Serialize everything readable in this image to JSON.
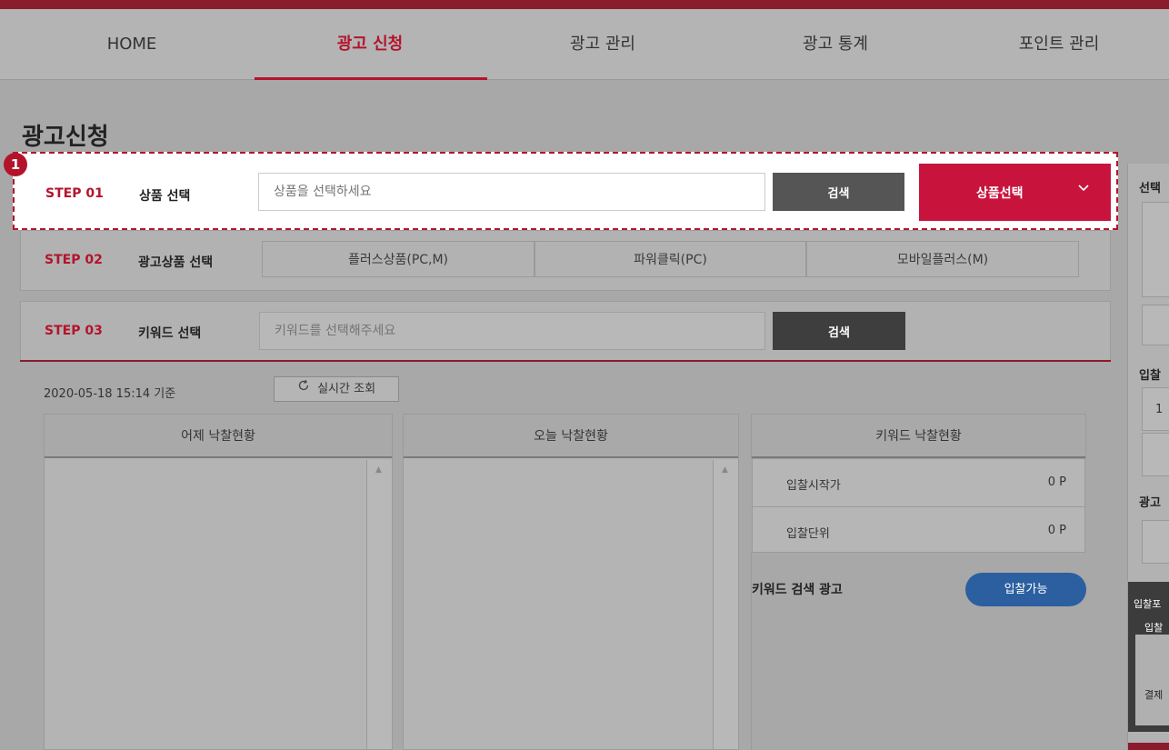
{
  "nav": {
    "items": [
      "HOME",
      "광고 신청",
      "광고 관리",
      "광고 통계",
      "포인트 관리"
    ],
    "active": "광고 신청"
  },
  "page": {
    "title": "광고신청",
    "callout_number": "1"
  },
  "step1": {
    "label": "STEP 01",
    "title": "상품 선택",
    "input_placeholder": "상품을 선택하세요",
    "search_label": "검색",
    "select_label": "상품선택",
    "select_icon": "chevron-down-icon"
  },
  "step2": {
    "label": "STEP 02",
    "title": "광고상품 선택",
    "options": [
      "플러스상품(PC,M)",
      "파워클릭(PC)",
      "모바일플러스(M)"
    ]
  },
  "step3": {
    "label": "STEP 03",
    "title": "키워드 선택",
    "input_placeholder": "키워드를 선택해주세요",
    "search_label": "검색"
  },
  "status": {
    "timestamp": "2020-05-18 15:14 기준",
    "refresh_label": "실시간 조회",
    "refresh_icon": "refresh-icon"
  },
  "panels": {
    "yesterday": "어제 낙찰현황",
    "today": "오늘 낙찰현황",
    "keyword": "키워드 낙찰현황"
  },
  "keyword_status": {
    "rows": [
      {
        "label": "입찰시작가",
        "value": "0 P"
      },
      {
        "label": "입찰단위",
        "value": "0 P"
      }
    ]
  },
  "keyword_ad": {
    "label": "키워드 검색 광고",
    "button": "입찰가능"
  },
  "side": {
    "t1": "선택",
    "t2": "입찰",
    "t3": "광고",
    "box_val1": "1",
    "dark_t1": "입찰포",
    "dark_t2": "입찰",
    "dark_t3": "결제"
  },
  "colors": {
    "accent": "#b3142c",
    "select_button": "#c8143c",
    "pill_button": "#2b5fa0"
  }
}
